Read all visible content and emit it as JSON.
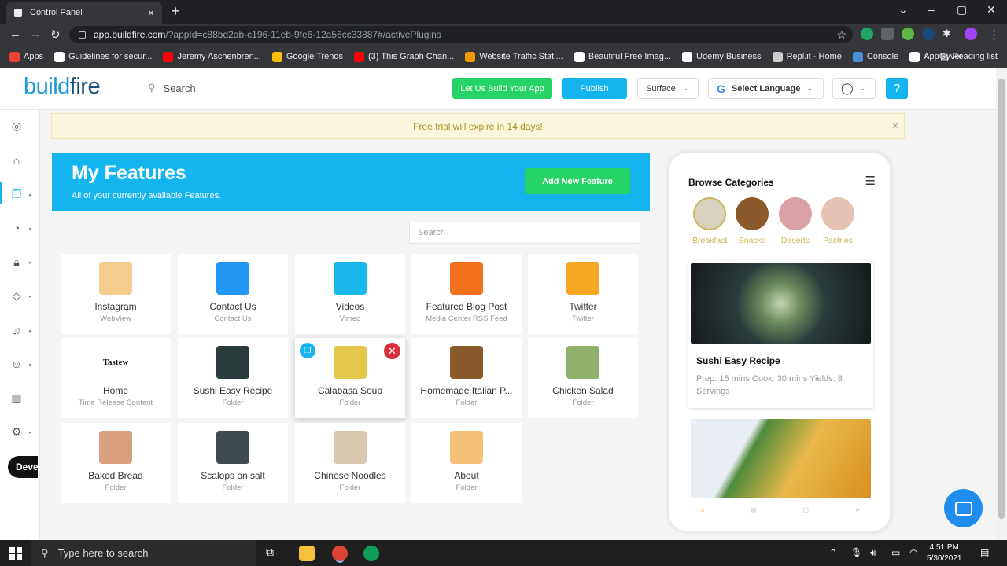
{
  "browser": {
    "tab_title": "Control Panel",
    "url_host": "app.buildfire.com",
    "url_path": "/?appId=c88bd2ab-c196-11eb-9fe6-12a56cc33887#/activePlugins",
    "bookmarks": [
      {
        "label": "Apps",
        "color": "#ea4335"
      },
      {
        "label": "Guidelines for secur...",
        "color": "#ffffff"
      },
      {
        "label": "Jeremy Aschenbren...",
        "color": "#ff0000"
      },
      {
        "label": "Google Trends",
        "color": "#fbbc05"
      },
      {
        "label": "(3) This Graph Chan...",
        "color": "#ff0000"
      },
      {
        "label": "Website Traffic Stati...",
        "color": "#f29900"
      },
      {
        "label": "Beautiful Free Imag...",
        "color": "#ffffff"
      },
      {
        "label": "Udemy Business",
        "color": "#ffffff"
      },
      {
        "label": "Repl.it - Home",
        "color": "#cccccc"
      },
      {
        "label": "Console",
        "color": "#4a90d9"
      },
      {
        "label": "AppGyver",
        "color": "#ffffff"
      }
    ],
    "reading_list": "Reading list"
  },
  "header": {
    "logo_part1": "build",
    "logo_part2": "fire",
    "search_placeholder": "Search",
    "build_btn": "Let Us Build Your App",
    "publish_btn": "Publish",
    "surface": "Surface",
    "language": "Select Language"
  },
  "sidebar": {
    "dev_label": "Deve"
  },
  "trial_banner": "Free trial will expire in 14 days!",
  "features": {
    "title": "My Features",
    "subtitle": "All of your currently available Features.",
    "add_btn": "Add New Feature",
    "search_placeholder": "Search",
    "cards": [
      {
        "title": "Instagram",
        "sub": "WebView",
        "color": "#f5ce8d"
      },
      {
        "title": "Contact Us",
        "sub": "Contact Us",
        "color": "#2196f3"
      },
      {
        "title": "Videos",
        "sub": "Vimeo",
        "color": "#1ab7ea"
      },
      {
        "title": "Featured Blog Post",
        "sub": "Media Center RSS Feed",
        "color": "#f2711c"
      },
      {
        "title": "Twitter",
        "sub": "Twitter",
        "color": "#f5a623"
      },
      {
        "title": "Home",
        "sub": "Time Release Content",
        "logo_text": "Tastew"
      },
      {
        "title": "Sushi Easy Recipe",
        "sub": "Folder",
        "color": "#2b3b3c"
      },
      {
        "title": "Calabasa Soup",
        "sub": "Folder",
        "color": "#e4c64a"
      },
      {
        "title": "Homemade Italian P...",
        "sub": "Folder",
        "color": "#8a5a2b"
      },
      {
        "title": "Chicken Salad",
        "sub": "Folder",
        "color": "#8fb06b"
      },
      {
        "title": "Baked Bread",
        "sub": "Folder",
        "color": "#d8a07e"
      },
      {
        "title": "Scalops on salt",
        "sub": "Folder",
        "color": "#3e4a4f"
      },
      {
        "title": "Chinese Noodles",
        "sub": "Folder",
        "color": "#d9c7ae"
      },
      {
        "title": "About",
        "sub": "Folder",
        "color": "#f5c27a"
      }
    ]
  },
  "preview": {
    "title": "Browse Categories",
    "categories": [
      {
        "label": "Breakfast",
        "color": "#d9d2c0"
      },
      {
        "label": "Snacks",
        "color": "#8a5a2b"
      },
      {
        "label": "Deserts",
        "color": "#d9a0a6"
      },
      {
        "label": "Pastries",
        "color": "#e6c2b2"
      }
    ],
    "recipe_title": "Sushi Easy Recipe",
    "recipe_desc": "Prep: 15 mins Cook: 30 mins Yields: 8 Servings"
  },
  "taskbar": {
    "search_placeholder": "Type here to search",
    "time": "4:51 PM",
    "date": "5/30/2021"
  }
}
